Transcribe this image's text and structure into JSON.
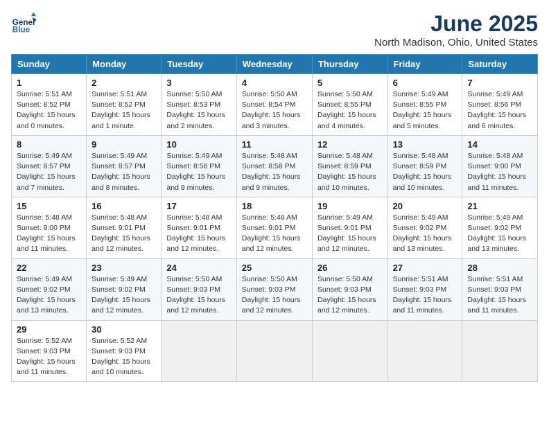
{
  "header": {
    "logo_line1": "General",
    "logo_line2": "Blue",
    "month": "June 2025",
    "location": "North Madison, Ohio, United States"
  },
  "weekdays": [
    "Sunday",
    "Monday",
    "Tuesday",
    "Wednesday",
    "Thursday",
    "Friday",
    "Saturday"
  ],
  "weeks": [
    [
      {
        "day": "1",
        "sunrise": "5:51 AM",
        "sunset": "8:52 PM",
        "daylight": "15 hours and 0 minutes."
      },
      {
        "day": "2",
        "sunrise": "5:51 AM",
        "sunset": "8:52 PM",
        "daylight": "15 hours and 1 minute."
      },
      {
        "day": "3",
        "sunrise": "5:50 AM",
        "sunset": "8:53 PM",
        "daylight": "15 hours and 2 minutes."
      },
      {
        "day": "4",
        "sunrise": "5:50 AM",
        "sunset": "8:54 PM",
        "daylight": "15 hours and 3 minutes."
      },
      {
        "day": "5",
        "sunrise": "5:50 AM",
        "sunset": "8:55 PM",
        "daylight": "15 hours and 4 minutes."
      },
      {
        "day": "6",
        "sunrise": "5:49 AM",
        "sunset": "8:55 PM",
        "daylight": "15 hours and 5 minutes."
      },
      {
        "day": "7",
        "sunrise": "5:49 AM",
        "sunset": "8:56 PM",
        "daylight": "15 hours and 6 minutes."
      }
    ],
    [
      {
        "day": "8",
        "sunrise": "5:49 AM",
        "sunset": "8:57 PM",
        "daylight": "15 hours and 7 minutes."
      },
      {
        "day": "9",
        "sunrise": "5:49 AM",
        "sunset": "8:57 PM",
        "daylight": "15 hours and 8 minutes."
      },
      {
        "day": "10",
        "sunrise": "5:49 AM",
        "sunset": "8:58 PM",
        "daylight": "15 hours and 9 minutes."
      },
      {
        "day": "11",
        "sunrise": "5:48 AM",
        "sunset": "8:58 PM",
        "daylight": "15 hours and 9 minutes."
      },
      {
        "day": "12",
        "sunrise": "5:48 AM",
        "sunset": "8:59 PM",
        "daylight": "15 hours and 10 minutes."
      },
      {
        "day": "13",
        "sunrise": "5:48 AM",
        "sunset": "8:59 PM",
        "daylight": "15 hours and 10 minutes."
      },
      {
        "day": "14",
        "sunrise": "5:48 AM",
        "sunset": "9:00 PM",
        "daylight": "15 hours and 11 minutes."
      }
    ],
    [
      {
        "day": "15",
        "sunrise": "5:48 AM",
        "sunset": "9:00 PM",
        "daylight": "15 hours and 11 minutes."
      },
      {
        "day": "16",
        "sunrise": "5:48 AM",
        "sunset": "9:01 PM",
        "daylight": "15 hours and 12 minutes."
      },
      {
        "day": "17",
        "sunrise": "5:48 AM",
        "sunset": "9:01 PM",
        "daylight": "15 hours and 12 minutes."
      },
      {
        "day": "18",
        "sunrise": "5:48 AM",
        "sunset": "9:01 PM",
        "daylight": "15 hours and 12 minutes."
      },
      {
        "day": "19",
        "sunrise": "5:49 AM",
        "sunset": "9:01 PM",
        "daylight": "15 hours and 12 minutes."
      },
      {
        "day": "20",
        "sunrise": "5:49 AM",
        "sunset": "9:02 PM",
        "daylight": "15 hours and 13 minutes."
      },
      {
        "day": "21",
        "sunrise": "5:49 AM",
        "sunset": "9:02 PM",
        "daylight": "15 hours and 13 minutes."
      }
    ],
    [
      {
        "day": "22",
        "sunrise": "5:49 AM",
        "sunset": "9:02 PM",
        "daylight": "15 hours and 13 minutes."
      },
      {
        "day": "23",
        "sunrise": "5:49 AM",
        "sunset": "9:02 PM",
        "daylight": "15 hours and 12 minutes."
      },
      {
        "day": "24",
        "sunrise": "5:50 AM",
        "sunset": "9:03 PM",
        "daylight": "15 hours and 12 minutes."
      },
      {
        "day": "25",
        "sunrise": "5:50 AM",
        "sunset": "9:03 PM",
        "daylight": "15 hours and 12 minutes."
      },
      {
        "day": "26",
        "sunrise": "5:50 AM",
        "sunset": "9:03 PM",
        "daylight": "15 hours and 12 minutes."
      },
      {
        "day": "27",
        "sunrise": "5:51 AM",
        "sunset": "9:03 PM",
        "daylight": "15 hours and 11 minutes."
      },
      {
        "day": "28",
        "sunrise": "5:51 AM",
        "sunset": "9:03 PM",
        "daylight": "15 hours and 11 minutes."
      }
    ],
    [
      {
        "day": "29",
        "sunrise": "5:52 AM",
        "sunset": "9:03 PM",
        "daylight": "15 hours and 11 minutes."
      },
      {
        "day": "30",
        "sunrise": "5:52 AM",
        "sunset": "9:03 PM",
        "daylight": "15 hours and 10 minutes."
      },
      null,
      null,
      null,
      null,
      null
    ]
  ]
}
